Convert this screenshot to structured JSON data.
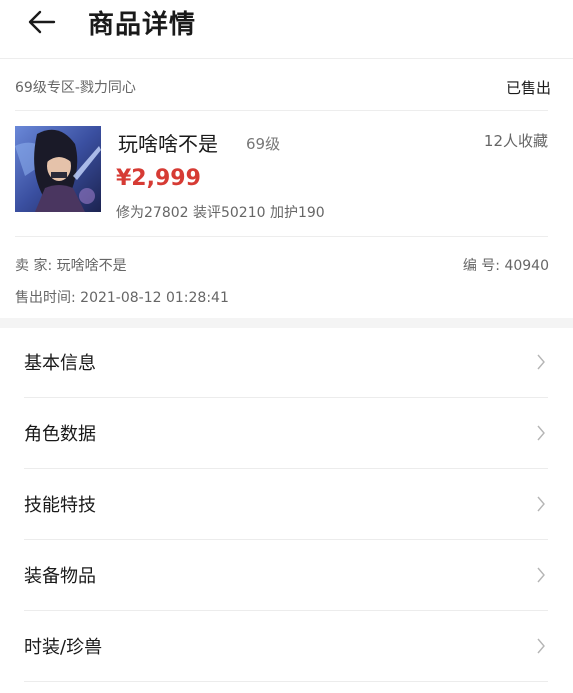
{
  "header": {
    "title": "商品详情"
  },
  "product": {
    "zone": "69级专区-戮力同心",
    "status": "已售出",
    "name": "玩啥啥不是",
    "level": "69级",
    "favorites": "12人收藏",
    "price": "¥2,999",
    "stats": "修为27802 装评50210 加护190"
  },
  "seller": {
    "seller_line": "卖 家: 玩啥啥不是",
    "code_line": "编 号: 40940",
    "sold_time_line": "售出时间: 2021-08-12 01:28:41"
  },
  "menu": [
    {
      "label": "基本信息"
    },
    {
      "label": "角色数据"
    },
    {
      "label": "技能特技"
    },
    {
      "label": "装备物品"
    },
    {
      "label": "时装/珍兽"
    }
  ],
  "colors": {
    "price": "#d63b34",
    "divider": "#ececec",
    "section_gap": "#f4f4f4"
  },
  "icons": {
    "back": "arrow-left-icon",
    "chevron": "chevron-right-icon"
  }
}
